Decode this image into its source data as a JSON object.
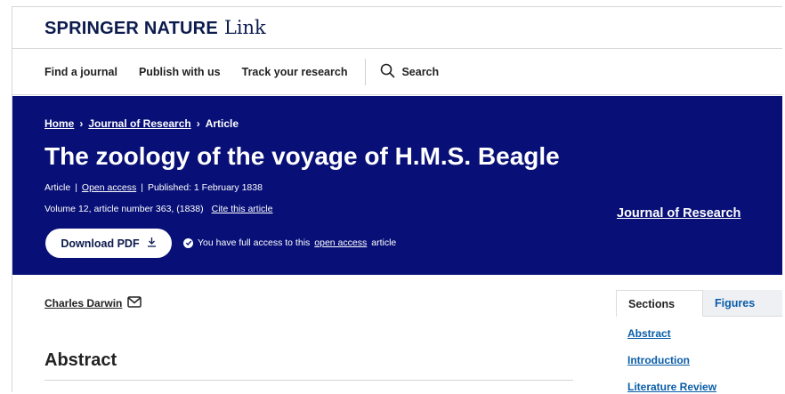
{
  "brand": {
    "name": "SPRINGER NATURE",
    "product": "Link"
  },
  "nav": {
    "items": [
      "Find a journal",
      "Publish with us",
      "Track your research"
    ],
    "search_label": "Search",
    "search_icon": "search-icon"
  },
  "hero": {
    "breadcrumb": {
      "home": "Home",
      "sep": "›",
      "journal": "Journal of Research",
      "current": "Article"
    },
    "title": "The zoology of the voyage of H.M.S. Beagle",
    "meta_type": "Article",
    "meta_sep": "|",
    "meta_access": "Open access",
    "meta_published": "Published: 1 February 1838",
    "meta_volume": "Volume 12, article number 363, (1838)",
    "cite_label": "Cite this article",
    "download_label": "Download PDF",
    "access_prefix": "You have full access to this",
    "access_link": "open access",
    "access_suffix": "article",
    "journal_link": "Journal of Research",
    "background_color": "#081077"
  },
  "author": {
    "name": "Charles Darwin",
    "icon": "mail-icon"
  },
  "main": {
    "abstract_heading": "Abstract"
  },
  "sidebar": {
    "tabs": [
      "Sections",
      "Figures"
    ],
    "links": [
      "Abstract",
      "Introduction",
      "Literature Review"
    ],
    "link_color": "#0a5da8"
  }
}
